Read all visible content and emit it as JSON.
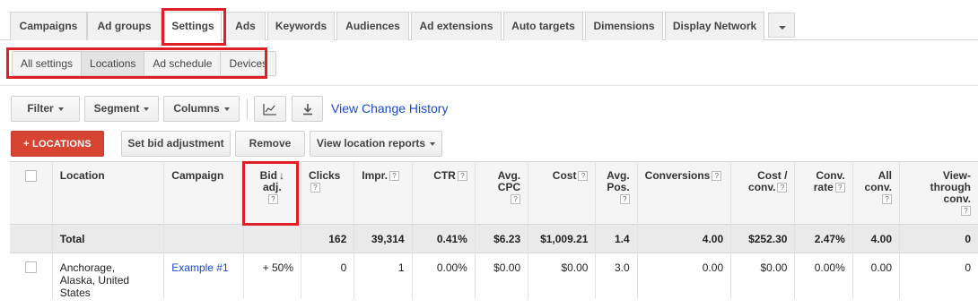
{
  "tabs": [
    {
      "label": "Campaigns"
    },
    {
      "label": "Ad groups"
    },
    {
      "label": "Settings",
      "active": true
    },
    {
      "label": "Ads"
    },
    {
      "label": "Keywords"
    },
    {
      "label": "Audiences"
    },
    {
      "label": "Ad extensions"
    },
    {
      "label": "Auto targets"
    },
    {
      "label": "Dimensions"
    },
    {
      "label": "Display Network"
    }
  ],
  "subtabs": [
    {
      "label": "All settings"
    },
    {
      "label": "Locations",
      "active": true
    },
    {
      "label": "Ad schedule"
    },
    {
      "label": "Devices"
    }
  ],
  "toolbar": {
    "filter": "Filter",
    "segment": "Segment",
    "columns": "Columns",
    "chart_icon": "line-chart-icon",
    "download_icon": "download-icon",
    "view_history": "View Change History"
  },
  "actions": {
    "add_locations": "+ LOCATIONS",
    "set_bid": "Set bid adjustment",
    "remove": "Remove",
    "view_reports": "View location reports"
  },
  "table": {
    "headers": {
      "location": "Location",
      "campaign": "Campaign",
      "bid_line1": "Bid",
      "bid_line2": "adj.",
      "clicks": "Clicks",
      "impr": "Impr.",
      "ctr": "CTR",
      "avg_cpc_1": "Avg.",
      "avg_cpc_2": "CPC",
      "cost": "Cost",
      "avg_pos_1": "Avg.",
      "avg_pos_2": "Pos.",
      "conversions": "Conversions",
      "cost_conv_1": "Cost /",
      "cost_conv_2": "conv.",
      "conv_rate_1": "Conv.",
      "conv_rate_2": "rate",
      "all_conv_1": "All",
      "all_conv_2": "conv.",
      "vt_1": "View-",
      "vt_2": "through",
      "vt_3": "conv.",
      "help_mark": "?"
    },
    "total": {
      "label": "Total",
      "clicks": "162",
      "impr": "39,314",
      "ctr": "0.41%",
      "avg_cpc": "$6.23",
      "cost": "$1,009.21",
      "avg_pos": "1.4",
      "conversions": "4.00",
      "cost_conv": "$252.30",
      "conv_rate": "2.47%",
      "all_conv": "4.00",
      "view_through": "0"
    },
    "rows": [
      {
        "location_1": "Anchorage,",
        "location_2": "Alaska, United",
        "location_3": "States",
        "campaign": "Example #1",
        "bid_adj": "+ 50%",
        "clicks": "0",
        "impr": "1",
        "ctr": "0.00%",
        "avg_cpc": "$0.00",
        "cost": "$0.00",
        "avg_pos": "3.0",
        "conversions": "0.00",
        "cost_conv": "$0.00",
        "conv_rate": "0.00%",
        "all_conv": "0.00",
        "view_through": "0"
      }
    ]
  },
  "colors": {
    "highlight": "#e01e25",
    "primary_button": "#d64532",
    "link": "#1a4ccd"
  }
}
